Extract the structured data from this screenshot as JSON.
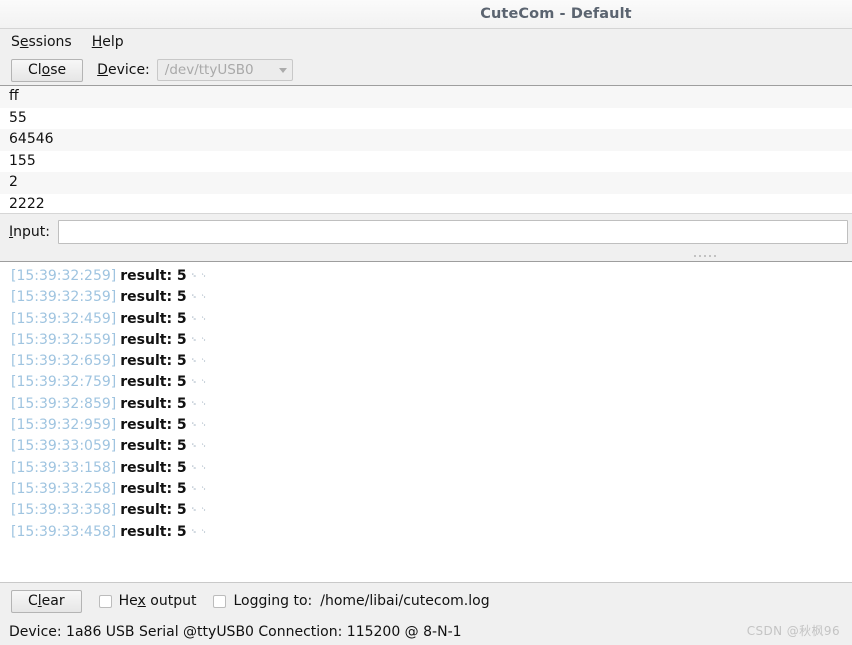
{
  "window": {
    "title": "CuteCom - Default"
  },
  "menubar": {
    "items": [
      {
        "label": "Sessions",
        "accel_index": 1
      },
      {
        "label": "Help",
        "accel_index": 0
      }
    ]
  },
  "toolbar": {
    "connect_button": "Close",
    "device_label": "Device:",
    "device_value": "/dev/ttyUSB0",
    "device_enabled": false
  },
  "history": {
    "rows": [
      "ff",
      "55",
      "64546",
      "155",
      "2",
      "2222"
    ]
  },
  "input": {
    "label": "Input:",
    "value": "",
    "placeholder": ""
  },
  "log": {
    "lines": [
      {
        "timestamp": "[15:39:32:259]",
        "message": "result: 5",
        "control": "CR LF"
      },
      {
        "timestamp": "[15:39:32:359]",
        "message": "result: 5",
        "control": "CR LF"
      },
      {
        "timestamp": "[15:39:32:459]",
        "message": "result: 5",
        "control": "CR LF"
      },
      {
        "timestamp": "[15:39:32:559]",
        "message": "result: 5",
        "control": "CR LF"
      },
      {
        "timestamp": "[15:39:32:659]",
        "message": "result: 5",
        "control": "CR LF"
      },
      {
        "timestamp": "[15:39:32:759]",
        "message": "result: 5",
        "control": "CR LF"
      },
      {
        "timestamp": "[15:39:32:859]",
        "message": "result: 5",
        "control": "CR LF"
      },
      {
        "timestamp": "[15:39:32:959]",
        "message": "result: 5",
        "control": "CR LF"
      },
      {
        "timestamp": "[15:39:33:059]",
        "message": "result: 5",
        "control": "CR LF"
      },
      {
        "timestamp": "[15:39:33:158]",
        "message": "result: 5",
        "control": "CR LF"
      },
      {
        "timestamp": "[15:39:33:258]",
        "message": "result: 5",
        "control": "CR LF"
      },
      {
        "timestamp": "[15:39:33:358]",
        "message": "result: 5",
        "control": "CR LF"
      },
      {
        "timestamp": "[15:39:33:458]",
        "message": "result: 5",
        "control": "CR LF"
      }
    ]
  },
  "bottombar": {
    "clear_button": "Clear",
    "hex_output_label": "Hex output",
    "hex_output_checked": false,
    "logging_label": "Logging to:",
    "logging_checked": false,
    "log_path": "/home/libai/cutecom.log"
  },
  "statusbar": {
    "text": "Device: 1a86 USB Serial @ttyUSB0  Connection: 115200 @ 8-N-1"
  },
  "watermark": {
    "text": "CSDN @秋枫96"
  },
  "colors": {
    "chrome": "#f0f0f0",
    "title_text": "#5b6470",
    "log_timestamp": "#9fc4e0",
    "log_text": "#111111",
    "disabled_text": "#a9a9a9",
    "list_alt_row": "#f7f7f7"
  }
}
